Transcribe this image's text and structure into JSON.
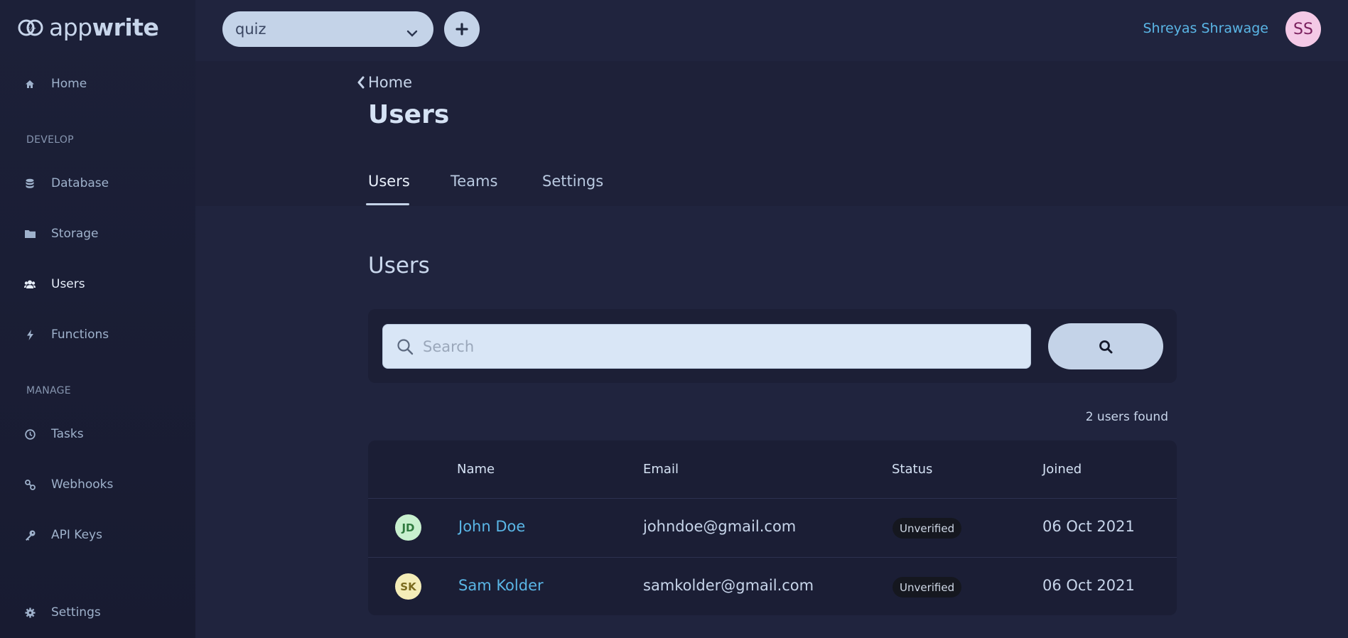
{
  "app": {
    "logo_text_light": "app",
    "logo_text_bold": "write"
  },
  "sidebar": {
    "items": [
      {
        "label": "Home",
        "icon": "home-icon"
      },
      {
        "label": "Database",
        "icon": "database-icon"
      },
      {
        "label": "Storage",
        "icon": "folder-icon"
      },
      {
        "label": "Users",
        "icon": "users-icon",
        "active": true
      },
      {
        "label": "Functions",
        "icon": "bolt-icon"
      },
      {
        "label": "Tasks",
        "icon": "clock-icon"
      },
      {
        "label": "Webhooks",
        "icon": "link-icon"
      },
      {
        "label": "API Keys",
        "icon": "key-icon"
      },
      {
        "label": "Settings",
        "icon": "gear-icon"
      }
    ],
    "sections": {
      "develop": "DEVELOP",
      "manage": "MANAGE"
    }
  },
  "topbar": {
    "project": "quiz",
    "user_name": "Shreyas Shrawage",
    "user_initials": "SS"
  },
  "header": {
    "breadcrumb": "Home",
    "title": "Users",
    "tabs": [
      {
        "label": "Users",
        "active": true
      },
      {
        "label": "Teams"
      },
      {
        "label": "Settings"
      }
    ]
  },
  "main": {
    "section_title": "Users",
    "search_placeholder": "Search",
    "result_count": "2 users found",
    "columns": [
      "Name",
      "Email",
      "Status",
      "Joined"
    ],
    "rows": [
      {
        "initials": "JD",
        "name": "John Doe",
        "email": "johndoe@gmail.com",
        "status": "Unverified",
        "joined": "06 Oct 2021",
        "avatar_bg": "#c8f0cf",
        "avatar_fg": "#2f7a3f"
      },
      {
        "initials": "SK",
        "name": "Sam Kolder",
        "email": "samkolder@gmail.com",
        "status": "Unverified",
        "joined": "06 Oct 2021",
        "avatar_bg": "#f4edb8",
        "avatar_fg": "#7a6a1e"
      }
    ]
  },
  "colors": {
    "accent_link": "#5ab6e6",
    "button_bg": "#c4d3e8",
    "page_bg": "#20243e"
  }
}
